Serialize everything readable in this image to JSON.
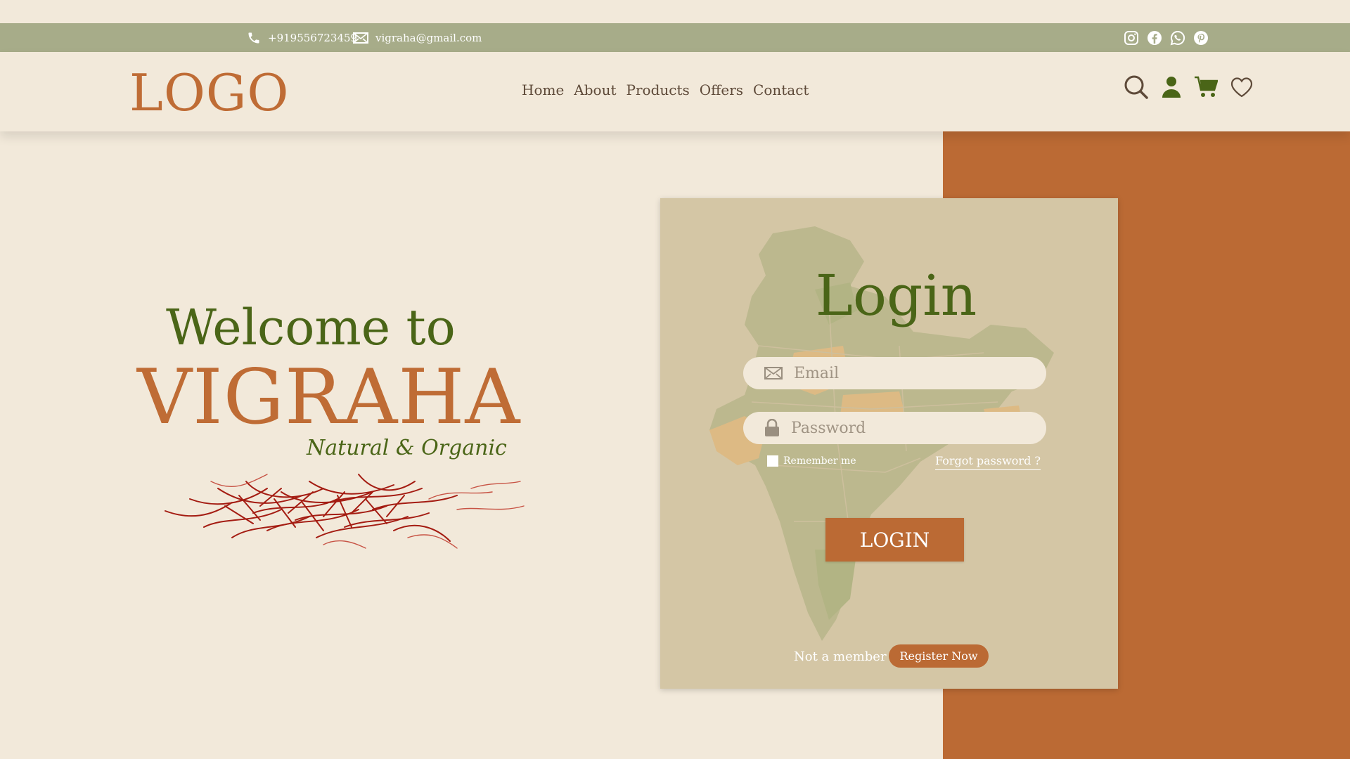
{
  "topbar": {
    "phone": "+919556723459",
    "email": "vigraha@gmail.com",
    "social_icons": [
      "instagram-icon",
      "facebook-icon",
      "whatsapp-icon",
      "pinterest-icon"
    ]
  },
  "header": {
    "logo": "LOGO",
    "nav": [
      "Home",
      "About",
      "Products",
      "Offers",
      "Contact"
    ],
    "action_icons": [
      "search-icon",
      "user-icon",
      "cart-icon",
      "heart-icon"
    ]
  },
  "hero": {
    "welcome": "Welcome to",
    "brand": "VIGRAHA",
    "tagline": "Natural & Organic"
  },
  "login": {
    "title": "Login",
    "email_placeholder": "Email",
    "password_placeholder": "Password",
    "remember_label": "Remember me",
    "forgot_label": "Forgot password ?",
    "login_button": "LOGIN",
    "not_member": "Not a member ?",
    "register_button": "Register Now"
  },
  "colors": {
    "background": "#f2e9da",
    "topbar": "#a7ac89",
    "accent_orange": "#bb6a34",
    "green": "#4a6517",
    "card": "#d4c6a5"
  }
}
